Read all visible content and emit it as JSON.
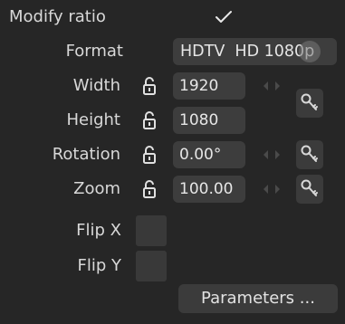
{
  "modify_ratio": {
    "label": "Modify ratio",
    "checked": true
  },
  "format": {
    "label": "Format",
    "value": "HDTV  HD 1080p"
  },
  "width": {
    "label": "Width",
    "value": "1920"
  },
  "height": {
    "label": "Height",
    "value": "1080"
  },
  "rotation": {
    "label": "Rotation",
    "value": "0.00°"
  },
  "zoom": {
    "label": "Zoom",
    "value": "100.00"
  },
  "flip_x": {
    "label": "Flip X",
    "checked": false
  },
  "flip_y": {
    "label": "Flip Y",
    "checked": false
  },
  "parameters_button": {
    "label": "Parameters ..."
  },
  "icons": {
    "lock": "lock-open-icon",
    "arrows": "left-right-arrows-icon",
    "key": "key-icon",
    "check": "checkmark-icon",
    "dropdown": "circle-dropdown-icon"
  }
}
